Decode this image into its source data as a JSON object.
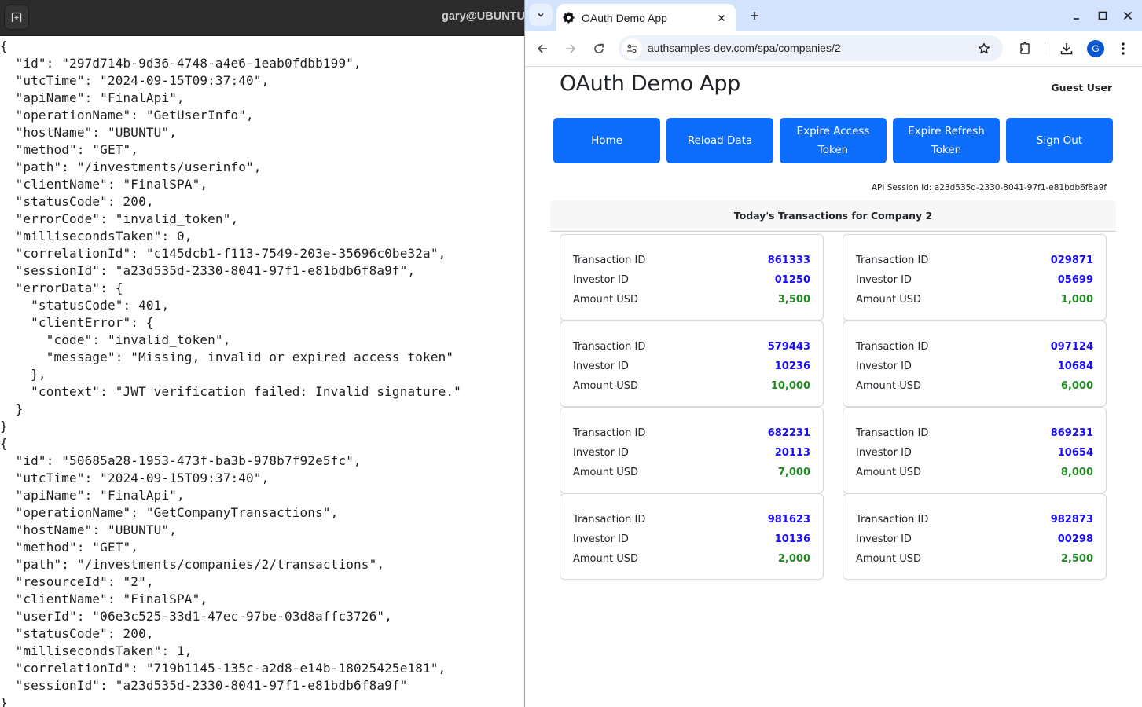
{
  "terminal": {
    "title": "gary@UBUNTU",
    "lines": [
      "{",
      "  \"id\": \"297d714b-9d36-4748-a4e6-1eab0fdbb199\",",
      "  \"utcTime\": \"2024-09-15T09:37:40\",",
      "  \"apiName\": \"FinalApi\",",
      "  \"operationName\": \"GetUserInfo\",",
      "  \"hostName\": \"UBUNTU\",",
      "  \"method\": \"GET\",",
      "  \"path\": \"/investments/userinfo\",",
      "  \"clientName\": \"FinalSPA\",",
      "  \"statusCode\": 200,",
      "  \"errorCode\": \"invalid_token\",",
      "  \"millisecondsTaken\": 0,",
      "  \"correlationId\": \"c145dcb1-f113-7549-203e-35696c0be32a\",",
      "  \"sessionId\": \"a23d535d-2330-8041-97f1-e81bdb6f8a9f\",",
      "  \"errorData\": {",
      "    \"statusCode\": 401,",
      "    \"clientError\": {",
      "      \"code\": \"invalid_token\",",
      "      \"message\": \"Missing, invalid or expired access token\"",
      "    },",
      "    \"context\": \"JWT verification failed: Invalid signature.\"",
      "  }",
      "}",
      "{",
      "  \"id\": \"50685a28-1953-473f-ba3b-978b7f92e5fc\",",
      "  \"utcTime\": \"2024-09-15T09:37:40\",",
      "  \"apiName\": \"FinalApi\",",
      "  \"operationName\": \"GetCompanyTransactions\",",
      "  \"hostName\": \"UBUNTU\",",
      "  \"method\": \"GET\",",
      "  \"path\": \"/investments/companies/2/transactions\",",
      "  \"resourceId\": \"2\",",
      "  \"clientName\": \"FinalSPA\",",
      "  \"userId\": \"06e3c525-33d1-47ec-97be-03d8affc3726\",",
      "  \"statusCode\": 200,",
      "  \"millisecondsTaken\": 1,",
      "  \"correlationId\": \"719b1145-135c-a2d8-e14b-18025425e181\",",
      "  \"sessionId\": \"a23d535d-2330-8041-97f1-e81bdb6f8a9f\"",
      "}"
    ]
  },
  "browser": {
    "tab_title": "OAuth Demo App",
    "new_tab_symbol": "+",
    "url": "authsamples-dev.com/spa/companies/2",
    "profile_initial": "G"
  },
  "app": {
    "title": "OAuth Demo App",
    "user": "Guest User",
    "buttons": [
      "Home",
      "Reload Data",
      "Expire Access Token",
      "Expire Refresh Token",
      "Sign Out"
    ],
    "session_label": "API Session Id: a23d535d-2330-8041-97f1-e81bdb6f8a9f",
    "panel_title": "Today's Transactions for Company 2",
    "labels": {
      "transaction_id": "Transaction ID",
      "investor_id": "Investor ID",
      "amount_usd": "Amount USD"
    },
    "colors": {
      "button": "#0d6efd",
      "id_value": "#1a0dff",
      "amount_value": "#218a21"
    },
    "transactions": [
      {
        "transaction_id": "861333",
        "investor_id": "01250",
        "amount_usd": "3,500"
      },
      {
        "transaction_id": "029871",
        "investor_id": "05699",
        "amount_usd": "1,000"
      },
      {
        "transaction_id": "579443",
        "investor_id": "10236",
        "amount_usd": "10,000"
      },
      {
        "transaction_id": "097124",
        "investor_id": "10684",
        "amount_usd": "6,000"
      },
      {
        "transaction_id": "682231",
        "investor_id": "20113",
        "amount_usd": "7,000"
      },
      {
        "transaction_id": "869231",
        "investor_id": "10654",
        "amount_usd": "8,000"
      },
      {
        "transaction_id": "981623",
        "investor_id": "10136",
        "amount_usd": "2,000"
      },
      {
        "transaction_id": "982873",
        "investor_id": "00298",
        "amount_usd": "2,500"
      }
    ]
  }
}
